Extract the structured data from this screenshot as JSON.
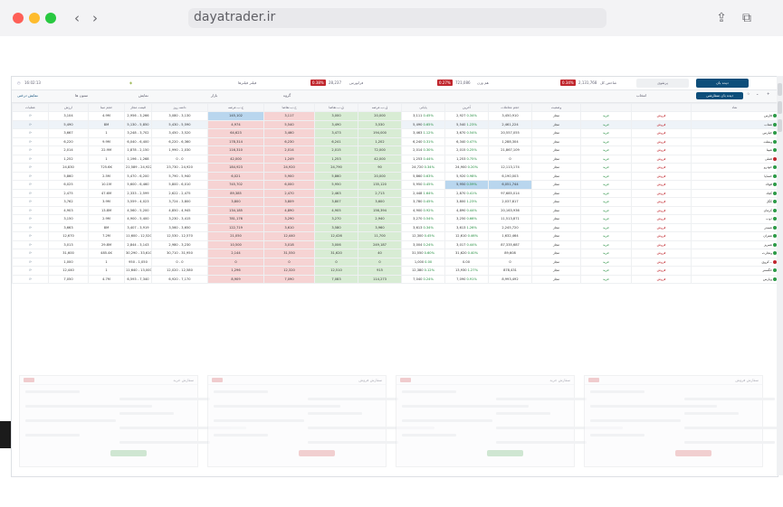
{
  "browser": {
    "url": "dayatrader.ir",
    "traffic_lights": [
      "#fe5f57",
      "#febc2e",
      "#28c840"
    ],
    "back_icon": "‹",
    "forward_icon": "›",
    "share_icon": "⇪",
    "tabs_icon": "⧉"
  },
  "topbar": {
    "time": "16:02:13",
    "dropdown_label": "فیلتر فیلترها",
    "index1": {
      "label": "شاخص کل",
      "value": "2,131,768",
      "change": "0.34%"
    },
    "index2": {
      "label": "هم وزن",
      "value": "721,086",
      "change": "0.27%"
    },
    "index3": {
      "label": "فرابورس",
      "value": "28,237",
      "change": "0.38%"
    },
    "primary_button": "دیده بان",
    "secondary_button": "پرتفوی"
  },
  "toolbar": {
    "new_list_button": "دیده بان سفارشی",
    "select_label": "انتخاب",
    "field_a": "گروه",
    "field_b": "بازار",
    "field_c": "ستون ها",
    "field_d": "نمایش",
    "tree_button": "نمایش درختی",
    "star_icon": "☆",
    "chevron_icon": "⌄",
    "add_icon": "+"
  },
  "table": {
    "headers": [
      "نماد",
      "",
      "",
      "وضعیت",
      "حجم معاملات",
      "آخرین",
      "پایانی",
      "ق.ب.عرضه",
      "ق.ب.تقاضا",
      "ح.ب.تقاضا",
      "ح.ب.عرضه",
      "دامنه روز",
      "قیمت مجاز",
      "حجم مبنا",
      "ارزش",
      "عملیات"
    ],
    "rows": [
      {
        "symbol": "فارس",
        "status": "مجاز",
        "action": "فروش",
        "bs": "خرید",
        "vol": "3,450,910",
        "last": "2,927",
        "last_pct": "0.34%",
        "close": "3,111",
        "close_pct": "0.45%",
        "ask": "20,000",
        "bid": "3,000",
        "bid_vol": "3,117",
        "ask_vol": "145,102",
        "range": "3,080 - 3,130",
        "allowed": "2,956 - 3,266",
        "base": "4.9M",
        "value": "3,104",
        "dot": "#2b9a46"
      },
      {
        "symbol": "شتاب",
        "status": "مجاز",
        "action": "فروش",
        "bs": "خرید",
        "vol": "2,461,224",
        "last": "5,540",
        "last_pct": "1.23%",
        "close": "5,490",
        "close_pct": "0.65%",
        "ask": "3,530",
        "bid": "3,490",
        "bid_vol": "5,540",
        "ask_vol": "4,974",
        "range": "5,430 - 5,590",
        "allowed": "5,130 - 5,850",
        "base": "8M",
        "value": "5,490",
        "dot": "#2b9a46"
      },
      {
        "symbol": "خپارس",
        "status": "مجاز",
        "action": "فروش",
        "bs": "خرید",
        "vol": "20,557,055",
        "last": "3,670",
        "last_pct": "0.54%",
        "close": "3,463",
        "close_pct": "1.12%",
        "ask": "194,000",
        "bid": "3,473",
        "bid_vol": "3,460",
        "ask_vol": "64,623",
        "range": "3,450 - 3,520",
        "allowed": "3,248 - 3,702",
        "base": "1",
        "value": "3,667",
        "dot": "#2b9a46"
      },
      {
        "symbol": "وبملت",
        "status": "مجاز",
        "action": "فروش",
        "bs": "خرید",
        "vol": "1,288,304",
        "last": "6,340",
        "last_pct": "0.47%",
        "close": "6,240",
        "close_pct": "0.31%",
        "ask": "1,202",
        "bid": "6,241",
        "bid_vol": "6,230",
        "ask_vol": "178,314",
        "range": "6,220 - 6,360",
        "allowed": "6,040 - 6,400",
        "base": "9.9M",
        "value": "6,220",
        "dot": "#2b9a46"
      },
      {
        "symbol": "شپنا",
        "status": "مجاز",
        "action": "فروش",
        "bs": "خرید",
        "vol": "21,867,109",
        "last": "2,015",
        "last_pct": "0.25%",
        "close": "2,014",
        "close_pct": "0.30%",
        "ask": "72,000",
        "bid": "2,015",
        "bid_vol": "2,014",
        "ask_vol": "116,310",
        "range": "1,990 - 2,030",
        "allowed": "1,878 - 2,150",
        "base": "22.9M",
        "value": "2,014",
        "dot": "#2b9a46"
      },
      {
        "symbol": "فملی",
        "status": "مجاز",
        "action": "فروش",
        "bs": "خرید",
        "vol": "0",
        "last": "1,253",
        "last_pct": "0.75%",
        "close": "1,253",
        "close_pct": "0.44%",
        "ask": "42,000",
        "bid": "1,253",
        "bid_vol": "1,249",
        "ask_vol": "42,000",
        "range": "0 - 0",
        "allowed": "1,196 - 1,268",
        "base": "1",
        "value": "1,252",
        "dot": "#c0262d"
      },
      {
        "symbol": "خودرو",
        "status": "مجاز",
        "action": "فروش",
        "bs": "خرید",
        "vol": "12,113,174",
        "last": "24,900",
        "last_pct": "0.20%",
        "close": "24,720",
        "close_pct": "0.34%",
        "ask": "90",
        "bid": "24,790",
        "bid_vol": "24,920",
        "ask_vol": "184,923",
        "range": "23,730 - 24,920",
        "allowed": "21,589 - 24,922",
        "base": "725.6K",
        "value": "24,830",
        "dot": "#2b9a46"
      },
      {
        "symbol": "خساپا",
        "status": "مجاز",
        "action": "فروش",
        "bs": "خرید",
        "vol": "6,190,003",
        "last": "5,920",
        "last_pct": "0.98%",
        "close": "5,860",
        "close_pct": "0.63%",
        "ask": "20,000",
        "bid": "5,860",
        "bid_vol": "5,900",
        "ask_vol": "6,021",
        "range": "5,790 - 5,940",
        "allowed": "5,470 - 6,200",
        "base": "2.5M",
        "value": "5,860",
        "dot": "#2b9a46"
      },
      {
        "symbol": "فولاد",
        "status": "مجاز",
        "action": "فروش",
        "bs": "خرید",
        "vol": "6,051,744",
        "last": "5,950",
        "last_pct": "0.59%",
        "close": "5,950",
        "close_pct": "0.45%",
        "ask": "135,120",
        "bid": "5,950",
        "bid_vol": "6,000",
        "ask_vol": "745,702",
        "range": "5,800 - 6,010",
        "allowed": "5,600 - 6,460",
        "base": "10.1M",
        "value": "6,025",
        "dot": "#2b9a46"
      },
      {
        "symbol": "کچاد",
        "status": "مجاز",
        "action": "فروش",
        "bs": "خرید",
        "vol": "97,685,014",
        "last": "2,870",
        "last_pct": "0.41%",
        "close": "2,448",
        "close_pct": "1.64%",
        "ask": "2,713",
        "bid": "2,463",
        "bid_vol": "2,470",
        "ask_vol": "89,385",
        "range": "2,622 - 2,475",
        "allowed": "2,333 - 2,599",
        "base": "47.6M",
        "value": "2,475",
        "dot": "#2b9a46"
      },
      {
        "symbol": "کگل",
        "status": "مجاز",
        "action": "فروش",
        "bs": "خرید",
        "vol": "2,037,817",
        "last": "3,800",
        "last_pct": "1.23%",
        "close": "3,780",
        "close_pct": "0.45%",
        "ask": "3,600",
        "bid": "3,807",
        "bid_vol": "3,809",
        "ask_vol": "3,800",
        "range": "3,724 - 3,800",
        "allowed": "3,559 - 4,023",
        "base": "3.9M",
        "value": "3,762",
        "dot": "#2b9a46"
      },
      {
        "symbol": "کرمان",
        "status": "مجاز",
        "action": "فروش",
        "bs": "خرید",
        "vol": "20,163,936",
        "last": "4,890",
        "last_pct": "0.44%",
        "close": "4,900",
        "close_pct": "0.92%",
        "ask": "156,394",
        "bid": "4,905",
        "bid_vol": "4,890",
        "ask_vol": "134,185",
        "range": "4,850 - 4,945",
        "allowed": "4,560 - 5,200",
        "base": "13.8M",
        "value": "4,903",
        "dot": "#2b9a46"
      },
      {
        "symbol": "ذوب",
        "status": "مجاز",
        "action": "فروش",
        "bs": "خرید",
        "vol": "11,513,871",
        "last": "3,250",
        "last_pct": "0.66%",
        "close": "3,270",
        "close_pct": "0.54%",
        "ask": "2,940",
        "bid": "3,270",
        "bid_vol": "3,290",
        "ask_vol": "781,176",
        "range": "3,230 - 3,415",
        "allowed": "4,900 - 5,400",
        "base": "2.9M",
        "value": "3,150",
        "dot": "#2b9a46"
      },
      {
        "symbol": "شبندر",
        "status": "مجاز",
        "action": "فروش",
        "bs": "خرید",
        "vol": "2,245,720",
        "last": "3,613",
        "last_pct": "1.26%",
        "close": "3,613",
        "close_pct": "0.34%",
        "ask": "3,960",
        "bid": "3,580",
        "bid_vol": "3,610",
        "ask_vol": "122,719",
        "range": "3,560 - 3,650",
        "allowed": "3,407 - 3,919",
        "base": "8M",
        "value": "3,663",
        "dot": "#2b9a46"
      },
      {
        "symbol": "شتران",
        "status": "مجاز",
        "action": "فروش",
        "bs": "خرید",
        "vol": "1,632,464",
        "last": "12,610",
        "last_pct": "0.46%",
        "close": "12,300",
        "close_pct": "0.45%",
        "ask": "11,700",
        "bid": "12,426",
        "bid_vol": "12,440",
        "ask_vol": "21,050",
        "range": "12,530 - 12,570",
        "allowed": "11,600 - 12,520",
        "base": "7.2M",
        "value": "12,670",
        "dot": "#2b9a46"
      },
      {
        "symbol": "شبریز",
        "status": "مجاز",
        "action": "فروش",
        "bs": "خرید",
        "vol": "87,335,687",
        "last": "3,017",
        "last_pct": "0.44%",
        "close": "3,004",
        "close_pct": "0.24%",
        "ask": "249,187",
        "bid": "3,006",
        "bid_vol": "3,018",
        "ask_vol": "10,500",
        "range": "2,980 - 3,230",
        "allowed": "2,844 - 3,143",
        "base": "29.8M",
        "value": "3,013",
        "dot": "#2b9a46"
      },
      {
        "symbol": "وتجارت",
        "status": "مجاز",
        "action": "فروش",
        "bs": "خرید",
        "vol": "89,608",
        "last": "31,620",
        "last_pct": "0.40%",
        "close": "31,550",
        "close_pct": "0.60%",
        "ask": "40",
        "bid": "31,620",
        "bid_vol": "31,550",
        "ask_vol": "2,144",
        "range": "30,710 - 31,950",
        "allowed": "30,290 - 33,610",
        "base": "485.4K",
        "value": "31,600",
        "dot": "#2b9a46"
      },
      {
        "symbol": "کروی...",
        "status": "مجاز",
        "action": "فروش",
        "bs": "خرید",
        "vol": "0",
        "last": "0.00",
        "last_pct": "",
        "close": "1,000",
        "close_pct": "0.00",
        "ask": "0",
        "bid": "0",
        "bid_vol": "0",
        "ask_vol": "0",
        "range": "0 - 0",
        "allowed": "950 - 1,050",
        "base": "1",
        "value": "1,000",
        "dot": "#c0262d"
      },
      {
        "symbol": "خگستر",
        "status": "مجاز",
        "action": "فروش",
        "bs": "خرید",
        "vol": "878,431",
        "last": "13,930",
        "last_pct": "1.27%",
        "close": "12,380",
        "close_pct": "0.12%",
        "ask": "915",
        "bid": "12,510",
        "bid_vol": "12,320",
        "ask_vol": "1,296",
        "range": "12,020 - 12,580",
        "allowed": "11,640 - 13,000",
        "base": "1",
        "value": "12,440",
        "dot": "#2b9a46"
      },
      {
        "symbol": "وپارس",
        "status": "مجاز",
        "action": "فروش",
        "bs": "خرید",
        "vol": "8,993,492",
        "last": "7,090",
        "last_pct": "0.91%",
        "close": "7,040",
        "close_pct": "0.24%",
        "ask": "114,273",
        "bid": "7,083",
        "bid_vol": "7,090",
        "ask_vol": "8,909",
        "range": "6,920 - 7,170",
        "allowed": "6,593 - 7,340",
        "base": "4.7M",
        "value": "7,050",
        "dot": "#2b9a46"
      }
    ]
  },
  "panels": [
    {
      "title": "سفارش خرید"
    },
    {
      "title": "سفارش فروش"
    },
    {
      "title": "سفارش خرید"
    },
    {
      "title": "سفارش فروش"
    }
  ],
  "colors": {
    "accent": "#0d4e7a",
    "up": "#1e8a3a",
    "down": "#c0262d",
    "bid_bg": "#d8ecd4",
    "ask_bg": "#f6d3d3"
  }
}
